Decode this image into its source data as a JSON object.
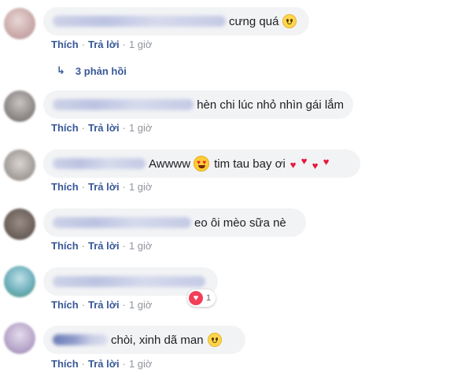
{
  "meta_labels": {
    "like": "Thích",
    "reply": "Trả lời",
    "dot": "·"
  },
  "comments": [
    {
      "text": "cưng quá",
      "time": "1 giờ",
      "emoji": "slightly-smiling-face"
    },
    {
      "text": "hèn chi lúc nhỏ nhìn gái lắm",
      "time": "1 giờ"
    },
    {
      "text": "Awwww",
      "text2": "tim tau bay ơi",
      "time": "1 giờ",
      "emoji": "heart-eyes-face"
    },
    {
      "text": "eo ôi mèo sữa nè",
      "time": "1 giờ"
    },
    {
      "text": "",
      "time": "1 giờ",
      "reaction_count": "1"
    },
    {
      "text": "chòi, xinh dã man",
      "time": "1 giờ",
      "emoji": "slightly-smiling-face"
    }
  ],
  "replies_link": "3 phản hồi",
  "colors": {
    "link": "#385898",
    "bubble": "#f2f3f5",
    "muted": "#90949c",
    "love": "#f33e58"
  }
}
